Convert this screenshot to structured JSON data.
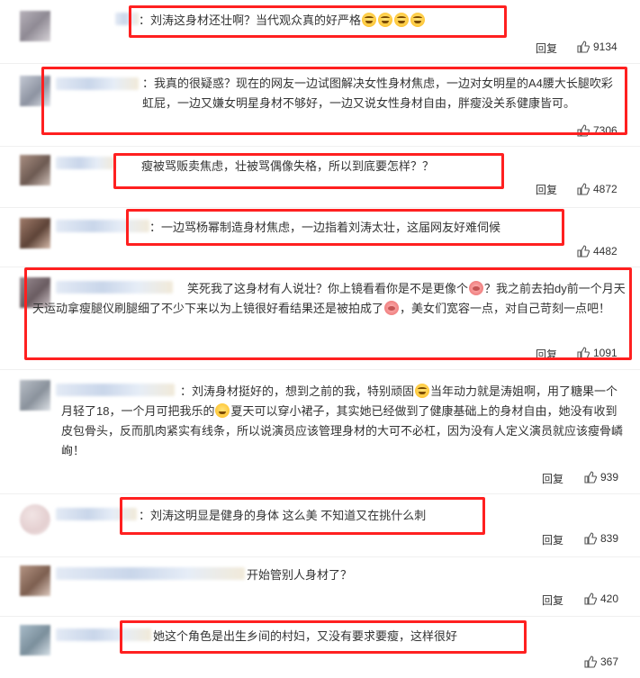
{
  "reply_label": "回复",
  "comments": [
    {
      "text": "：刘涛这身材还壮啊？当代观众真的好严格",
      "emoji_names": [
        "laugh-emoji",
        "laugh-emoji",
        "laugh-emoji",
        "laugh-emoji"
      ],
      "likes": "9134"
    },
    {
      "text": "：我真的很疑惑？现在的网友一边试图解决女性身材焦虑，一边对女明星的A4腰大长腿吹彩虹屁，一边又嫌女明星身材不够好，一边又说女性身材自由，胖瘦没关系健康皆可。",
      "likes": "7306"
    },
    {
      "text": "瘦被骂贩卖焦虑，壮被骂偶像失格，所以到底要怎样？？",
      "likes": "4872"
    },
    {
      "text": "：一边骂杨幂制造身材焦虑，一边指着刘涛太壮，这届网友好难伺候",
      "likes": "4482"
    },
    {
      "text_a": "笑死我了这身材有人说壮？你上镜看看你是不是更像个",
      "text_b": "？我之前去拍dy前一个月天天运动拿瘦腿仪刷腿细了不少下来以为上镜很好看结果还是被拍成了",
      "text_c": "，美女们宽容一点，对自己苛刻一点吧！",
      "likes": "1091"
    },
    {
      "text_a": "：刘涛身材挺好的，想到之前的我，特别顽固",
      "text_b": "当年动力就是涛姐啊，用了糖果一个月轻了18，一个月可把我乐的",
      "text_c": "夏天可以穿小裙子，其实她已经做到了健康基础上的身材自由，她没有收到皮包骨头，反而肌肉紧实有线条，所以说演员应该管理身材的大可不必杠，因为没有人定义演员就应该瘦骨嶙峋！",
      "likes": "939"
    },
    {
      "text": "：刘涛这明显是健身的身体 这么美 不知道又在挑什么刺",
      "likes": "839"
    },
    {
      "text": "开始管别人身材了？",
      "likes": "420"
    },
    {
      "text": "她这个角色是出生乡间的村妇，又没有要求要瘦，这样很好",
      "likes": "367"
    }
  ]
}
